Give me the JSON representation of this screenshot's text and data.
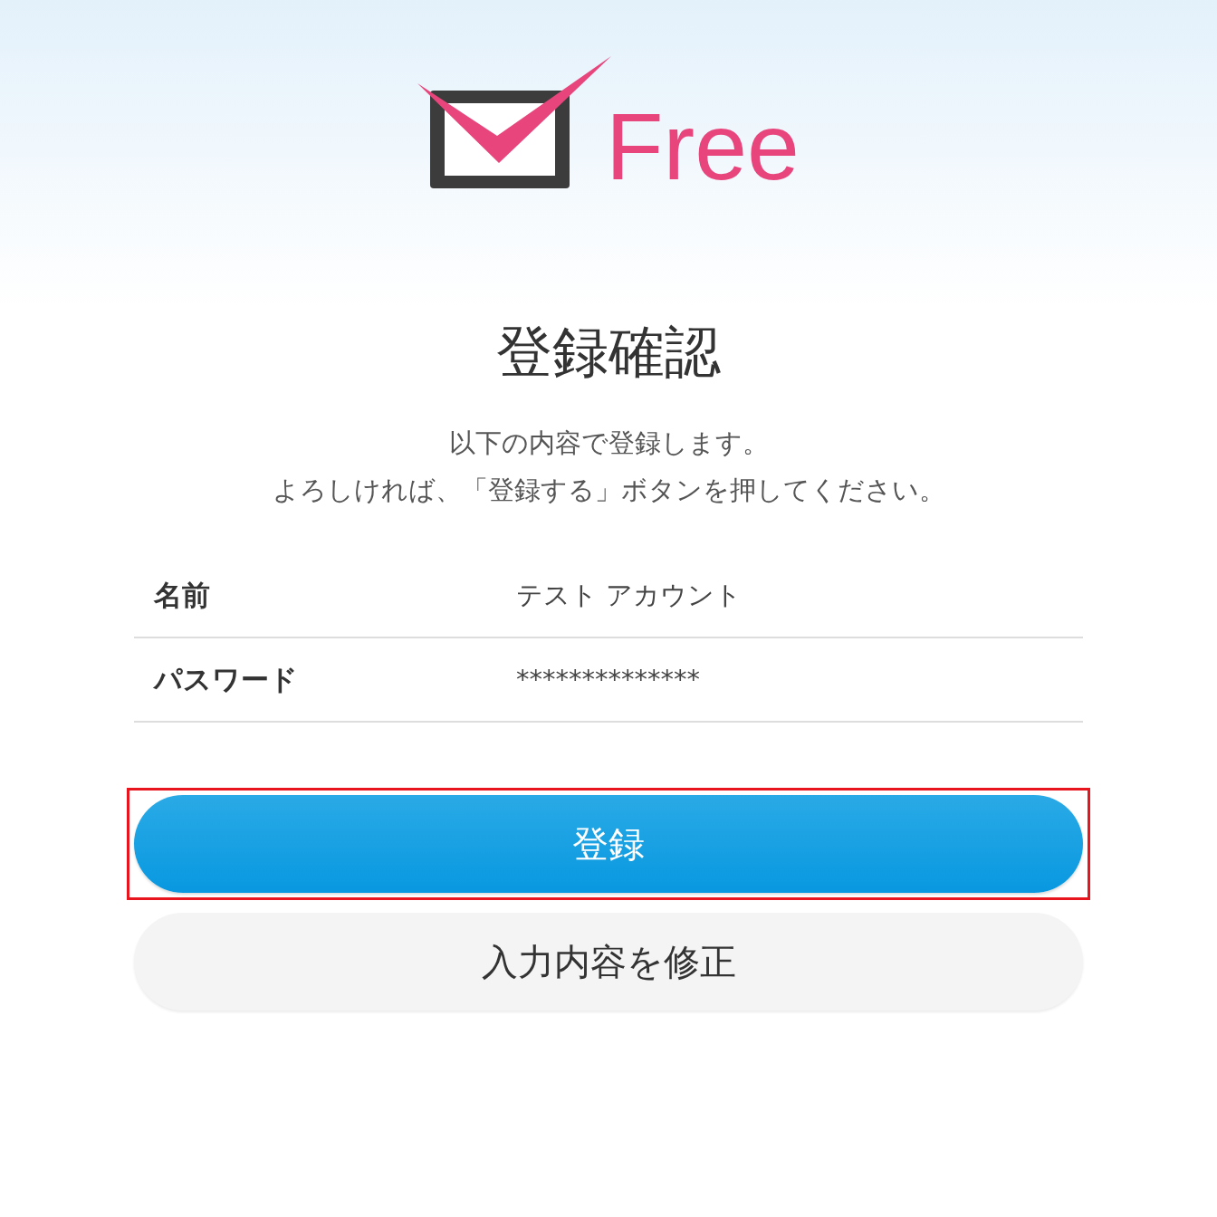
{
  "logo": {
    "text": "Free"
  },
  "title": "登録確認",
  "message": [
    "以下の内容で登録します。",
    "よろしければ、「登録する」ボタンを押してください。"
  ],
  "fields": [
    {
      "label": "名前",
      "value": "テスト アカウント"
    },
    {
      "label": "パスワード",
      "value": "**************"
    }
  ],
  "buttons": [
    {
      "label": "登録",
      "kind": "primary",
      "highlighted": true
    },
    {
      "label": "入力内容を修正",
      "kind": "secondary",
      "highlighted": false
    }
  ]
}
